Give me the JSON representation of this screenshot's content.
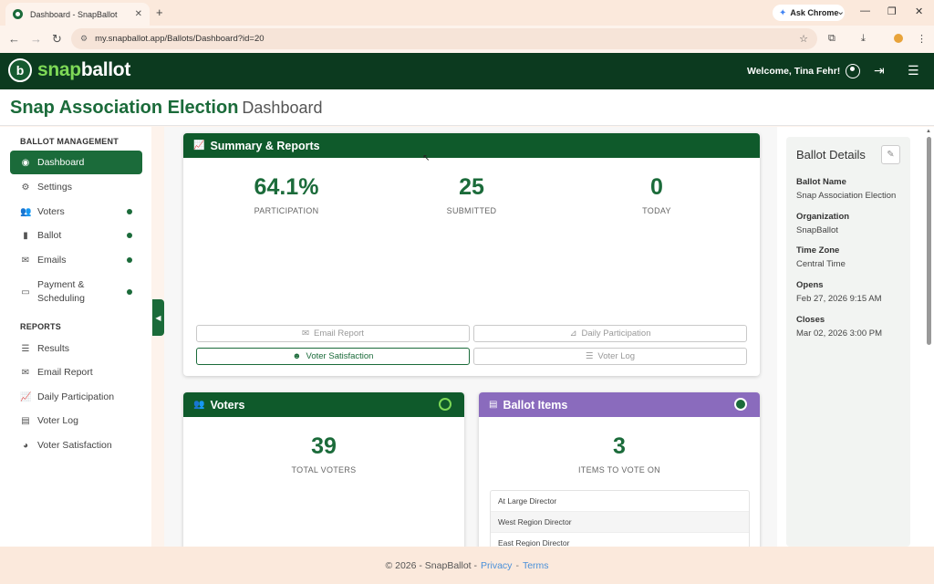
{
  "browser": {
    "tab_title": "Dashboard - SnapBallot",
    "tab_close": "✕",
    "new_tab": "+",
    "ask_chrome": "Ask Chrome",
    "url": "my.snapballot.app/Ballots/Dashboard?id=20"
  },
  "header": {
    "logo_snap": "snap",
    "logo_ballot": "ballot",
    "welcome": "Welcome, Tina Fehr!"
  },
  "page": {
    "title": "Snap Association Election",
    "subtitle": "Dashboard"
  },
  "sidebar": {
    "section1": "BALLOT MANAGEMENT",
    "items": [
      {
        "label": "Dashboard",
        "icon": "dashboard-icon"
      },
      {
        "label": "Settings",
        "icon": "gear-icon"
      },
      {
        "label": "Voters",
        "icon": "users-icon"
      },
      {
        "label": "Ballot",
        "icon": "ballot-icon"
      },
      {
        "label": "Emails",
        "icon": "envelope-icon"
      },
      {
        "label": "Payment &",
        "label2": "Scheduling",
        "icon": "credit-card-icon"
      }
    ],
    "section2": "REPORTS",
    "reports": [
      {
        "label": "Results",
        "icon": "list-icon"
      },
      {
        "label": "Email Report",
        "icon": "envelope-open-icon"
      },
      {
        "label": "Daily Participation",
        "icon": "chart-line-icon"
      },
      {
        "label": "Voter Log",
        "icon": "book-icon"
      },
      {
        "label": "Voter Satisfaction",
        "icon": "pie-chart-icon"
      }
    ]
  },
  "summary": {
    "title": "Summary & Reports",
    "participation_value": "64.1%",
    "participation_label": "PARTICIPATION",
    "submitted_value": "25",
    "submitted_label": "SUBMITTED",
    "today_value": "0",
    "today_label": "TODAY",
    "buttons": {
      "email_report": "Email Report",
      "daily_participation": "Daily Participation",
      "voter_satisfaction": "Voter Satisfaction",
      "voter_log": "Voter Log"
    }
  },
  "voters_card": {
    "title": "Voters",
    "value": "39",
    "label": "TOTAL VOTERS"
  },
  "ballot_items": {
    "title": "Ballot Items",
    "value": "3",
    "label": "ITEMS TO VOTE ON",
    "rows": [
      "At Large Director",
      "West Region Director",
      "East Region Director"
    ]
  },
  "details": {
    "title": "Ballot Details",
    "ballot_name_label": "Ballot Name",
    "ballot_name": "Snap Association Election",
    "organization_label": "Organization",
    "organization": "SnapBallot",
    "timezone_label": "Time Zone",
    "timezone": "Central Time",
    "opens_label": "Opens",
    "opens": "Feb 27, 2026 9:15 AM",
    "closes_label": "Closes",
    "closes": "Mar 02, 2026 3:00 PM"
  },
  "footer": {
    "copyright": "© 2026 - SnapBallot -",
    "privacy": "Privacy",
    "sep": "-",
    "terms": "Terms"
  },
  "colors": {
    "brand_green": "#1b6b3a",
    "header_dark": "#0c3a1f",
    "ballot_purple": "#8a6bbd"
  }
}
